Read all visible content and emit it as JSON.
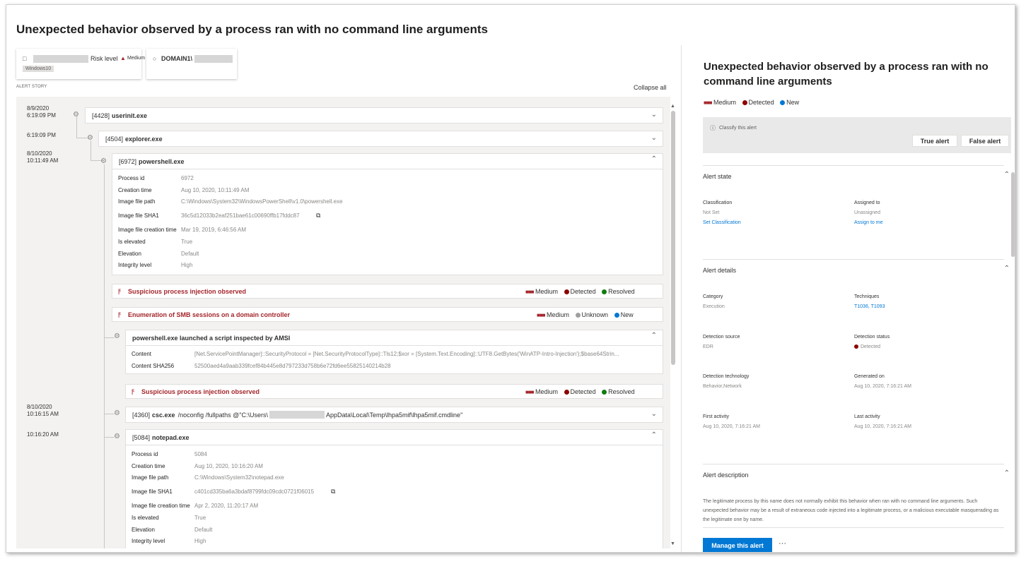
{
  "page_title": "Unexpected behavior observed by a process ran with no command line arguments",
  "device_card": {
    "risk_label": "Risk level",
    "risk_value": "Medium",
    "os_badge": "Windows10",
    "user": "DOMAIN1\\"
  },
  "story": {
    "caption": "ALERT STORY",
    "collapse_all": "Collapse all",
    "times": [
      "8/9/2020",
      "6:19:09 PM",
      "6:19:09 PM",
      "8/10/2020",
      "10:11:49 AM",
      "8/10/2020",
      "10:16:15 AM",
      "10:16:20 AM"
    ],
    "userinit": {
      "pid": "[4428]",
      "name": "userinit.exe"
    },
    "explorer": {
      "pid": "[4504]",
      "name": "explorer.exe"
    },
    "powershell": {
      "pid": "[6972]",
      "name": "powershell.exe"
    },
    "ps_details": {
      "labels": [
        "Process id",
        "Creation time",
        "Image file path",
        "Image file SHA1",
        "Image file creation time",
        "Is elevated",
        "Elevation",
        "Integrity level"
      ],
      "values": [
        "6972",
        "Aug 10, 2020, 10:11:49 AM",
        "C:\\Windows\\System32\\WindowsPowerShell\\v1.0\\powershell.exe",
        "36c5d12033b2eaf251bae61c00690ffb17fddc87",
        "Mar 19, 2019, 6:46:56 AM",
        "True",
        "Default",
        "High"
      ]
    },
    "alert1": {
      "title": "Suspicious process injection observed",
      "severity": "Medium",
      "status": "Detected",
      "state": "Resolved"
    },
    "alert2": {
      "title": "Enumeration of SMB sessions on a domain controller",
      "severity": "Medium",
      "status": "Unknown",
      "state": "New"
    },
    "amsi": {
      "title": "powershell.exe launched a script inspected by AMSI",
      "content_label": "Content",
      "content_value": "[Net.ServicePointManager]::SecurityProtocol = [Net.SecurityProtocolType]::Tls12;$xor = [System.Text.Encoding]::UTF8.GetBytes('WinATP-Intro-Injection');$base64Strin...",
      "sha_label": "Content SHA256",
      "sha_value": "52500aed4a9aab339fcef84b445e8d797233d758b6e72fd6ee55825140214b28"
    },
    "alert3": {
      "title": "Suspicious process injection observed",
      "severity": "Medium",
      "status": "Detected",
      "state": "Resolved"
    },
    "csc": {
      "pid": "[4360]",
      "name": "csc.exe",
      "args_pre": "/noconfig /fullpaths @\"C:\\Users\\",
      "args_post": "AppData\\Local\\Temp\\lhpa5mif\\lhpa5mif.cmdline\""
    },
    "notepad": {
      "pid": "[5084]",
      "name": "notepad.exe"
    },
    "np_details": {
      "labels": [
        "Process id",
        "Creation time",
        "Image file path",
        "Image file SHA1",
        "Image file creation time",
        "Is elevated",
        "Elevation",
        "Integrity level"
      ],
      "values": [
        "5084",
        "Aug 10, 2020, 10:16:20 AM",
        "C:\\Windows\\System32\\notepad.exe",
        "c401cd335ba6a3bdaf8799fdc09cdc0721f06015",
        "Apr 2, 2020, 11:20:17 AM",
        "True",
        "Default",
        "High"
      ]
    }
  },
  "panel": {
    "title": "Unexpected behavior observed by a process ran with no command line arguments",
    "severity": "Medium",
    "status": "Detected",
    "state": "New",
    "classify_label": "Classify this alert",
    "true_alert": "True alert",
    "false_alert": "False alert",
    "alert_state": {
      "header": "Alert state",
      "classification_k": "Classification",
      "classification_v": "Not Set",
      "classification_link": "Set Classification",
      "assigned_k": "Assigned to",
      "assigned_v": "Unassigned",
      "assigned_link": "Assign to me"
    },
    "alert_details": {
      "header": "Alert details",
      "category_k": "Category",
      "category_v": "Execution",
      "techniques_k": "Techniques",
      "techniques_v": "T1036, T1093",
      "det_source_k": "Detection source",
      "det_source_v": "EDR",
      "det_status_k": "Detection status",
      "det_status_v": "Detected",
      "det_tech_k": "Detection technology",
      "det_tech_v": "Behavior,Network",
      "generated_k": "Generated on",
      "generated_v": "Aug 10, 2020, 7:16:21 AM",
      "first_k": "First activity",
      "first_v": "Aug 10, 2020, 7:16:21 AM",
      "last_k": "Last activity",
      "last_v": "Aug 10, 2020, 7:16:21 AM"
    },
    "description": {
      "header": "Alert description",
      "text": "The legitimate process by this name does not normally exhibit this behavior when ran with no command line arguments. Such unexpected behavior may be a result of extraneous code injected into a legitimate process, or a malicious executable masquerading as the legitimate one by name."
    },
    "manage": "Manage this alert",
    "more": "···"
  },
  "colors": {
    "severity": "#a4262c",
    "detected": "#8b0000",
    "resolved": "#107c10",
    "unknown": "#8a8886",
    "new": "#0078d4",
    "primary": "#0078d4"
  }
}
